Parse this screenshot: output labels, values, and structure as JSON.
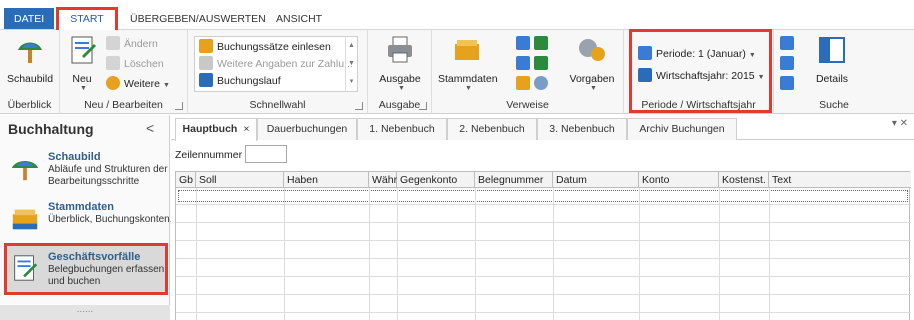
{
  "menu": {
    "file": "DATEI",
    "start": "START",
    "uebergeben": "ÜBERGEBEN/AUSWERTEN",
    "ansicht": "ANSICHT"
  },
  "ribbon": {
    "ueberblick": {
      "button": "Schaubild",
      "label": "Überblick"
    },
    "neu": {
      "new": "Neu",
      "aendern": "Ändern",
      "loeschen": "Löschen",
      "weitere": "Weitere",
      "label": "Neu / Bearbeiten"
    },
    "schnellwahl": {
      "items": [
        "Buchungssätze einlesen",
        "Weitere Angaben zur Zahlu...",
        "Buchungslauf"
      ],
      "label": "Schnellwahl"
    },
    "ausgabe": {
      "button": "Ausgabe",
      "label": "Ausgabe"
    },
    "verweise": {
      "stammdaten": "Stammdaten",
      "vorgaben": "Vorgaben",
      "label": "Verweise"
    },
    "periode": {
      "periode": "Periode: 1 (Januar)",
      "wirtschaftsjahr": "Wirtschaftsjahr: 2015",
      "label": "Periode / Wirtschaftsjahr"
    },
    "suche": {
      "details": "Details",
      "label": "Suche"
    }
  },
  "sidebar": {
    "title": "Buchhaltung",
    "collapse": "<",
    "items": [
      {
        "head": "Schaubild",
        "desc": "Abläufe und Strukturen der Bearbeitungsschritte"
      },
      {
        "head": "Stammdaten",
        "desc": "Überblick, Buchungskonten,"
      },
      {
        "head": "Geschäftsvorfälle",
        "desc": "Belegbuchungen erfassen und buchen"
      }
    ],
    "grip": "......"
  },
  "tabs": [
    {
      "label": "Hauptbuch",
      "close": "×"
    },
    {
      "label": "Dauerbuchungen"
    },
    {
      "label": "1. Nebenbuch"
    },
    {
      "label": "2. Nebenbuch"
    },
    {
      "label": "3. Nebenbuch"
    },
    {
      "label": "Archiv Buchungen"
    }
  ],
  "pane_controls": "▾ ✕",
  "form": {
    "zeilennummer_label": "Zeilennummer",
    "zeilennummer_value": ""
  },
  "grid": {
    "columns": [
      "Gb",
      "Soll",
      "Haben",
      "Währ",
      "Gegenkonto",
      "Belegnummer",
      "Datum",
      "Konto",
      "Kostenst.",
      "Text"
    ]
  },
  "colors": {
    "accent": "#2b6cb8",
    "highlight": "#e23a2e"
  }
}
